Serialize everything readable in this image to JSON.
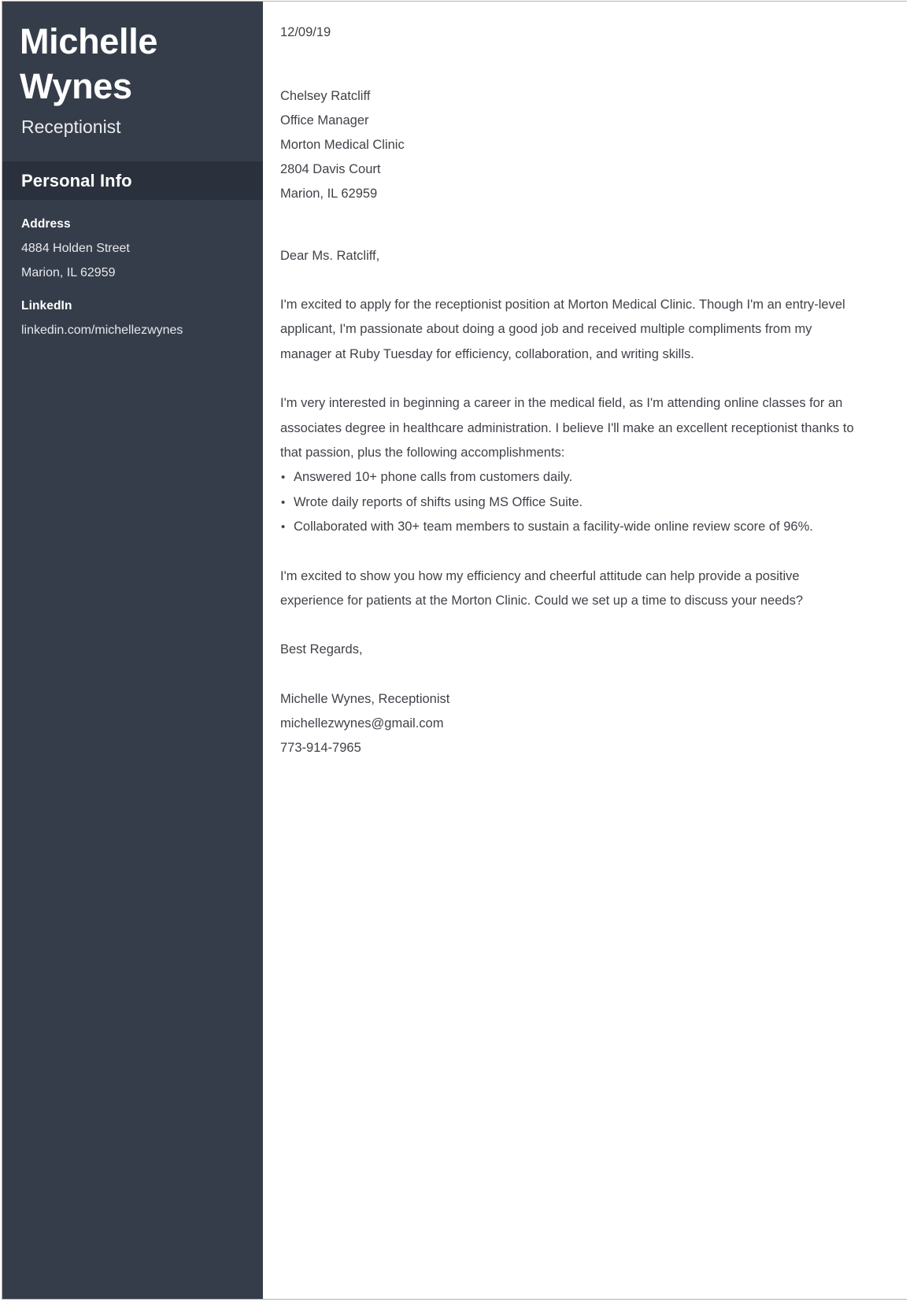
{
  "sidebar": {
    "name": "Michelle Wynes",
    "job_title": "Receptionist",
    "section_title": "Personal Info",
    "fields": [
      {
        "label": "Address",
        "lines": [
          "4884 Holden Street",
          "Marion, IL 62959"
        ]
      },
      {
        "label": "LinkedIn",
        "lines": [
          "linkedin.com/michellezwynes"
        ]
      }
    ]
  },
  "letter": {
    "date": "12/09/19",
    "recipient": [
      "Chelsey Ratcliff",
      "Office Manager",
      "Morton Medical Clinic",
      "2804 Davis Court",
      "Marion, IL 62959"
    ],
    "salutation": "Dear Ms. Ratcliff,",
    "paragraph_1": "I'm excited to apply for the receptionist position at Morton Medical Clinic. Though I'm an entry-level applicant, I'm passionate about doing a good job and received multiple compliments from my manager at Ruby Tuesday for efficiency, collaboration, and writing skills.",
    "paragraph_2": "I'm very interested in beginning a career in the medical field, as I'm attending online classes for an associates degree in healthcare administration. I believe I'll make an excellent receptionist thanks to that passion, plus the following accomplishments:",
    "bullets": [
      "Answered 10+ phone calls from customers daily.",
      "Wrote daily reports of shifts using MS Office Suite.",
      "Collaborated with 30+ team members to sustain a facility-wide online review score of 96%."
    ],
    "paragraph_3": "I'm excited to show you how my efficiency and cheerful attitude can help provide a positive experience for patients at the Morton Clinic. Could we set up a time to discuss your needs?",
    "closing": "Best Regards,",
    "signature": [
      "Michelle Wynes, Receptionist",
      "michellezwynes@gmail.com",
      "773-914-7965"
    ]
  },
  "colors": {
    "sidebar_background": "#363d4a",
    "sidebar_band": "#2b313c",
    "body_text": "#3f4248",
    "page_border": "#b4b3a9",
    "page_background": "#ffffff"
  }
}
